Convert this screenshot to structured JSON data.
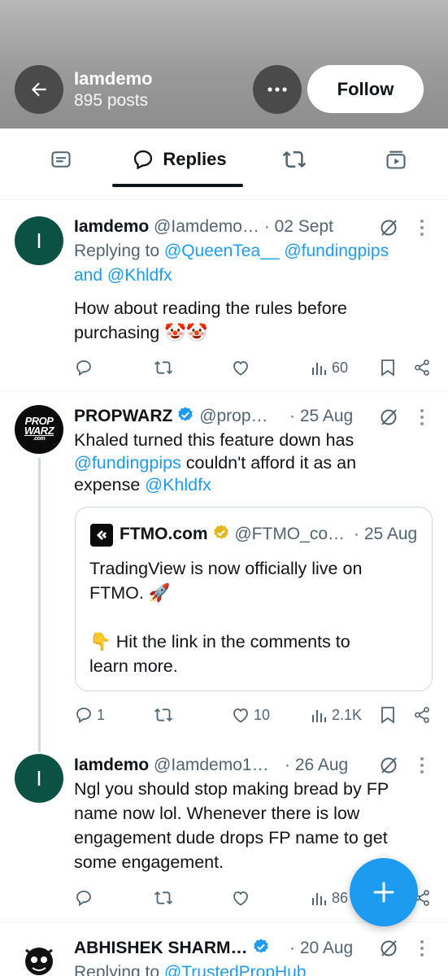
{
  "header": {
    "name": "Iamdemo",
    "posts_count": "895 posts",
    "follow_label": "Follow"
  },
  "tabs": {
    "replies_label": "Replies"
  },
  "posts": [
    {
      "name": "Iamdemo",
      "handle": "@Iamdemo…",
      "date": "· 02 Sept",
      "replying_prefix": "Replying to",
      "replying_to_1": "@QueenTea__",
      "replying_to_2": "@fundingpips",
      "replying_and": "and",
      "replying_to_3": "@Khldfx",
      "text_line_1": "How about reading the rules before",
      "text_line_2": "purchasing 🤡🤡",
      "stats": {
        "replies": "",
        "reposts": "",
        "likes": "",
        "views": "60"
      }
    },
    {
      "name": "PROPWARZ",
      "handle": "@prop…",
      "date": "· 25 Aug",
      "avatar_text_1": "PROP",
      "avatar_text_2": "WARZ",
      "avatar_text_3": ".com",
      "text_line_1": "Khaled turned this feature down has",
      "text_line_2_link": "@fundingpips",
      "text_line_2_rest": " couldn't afford it as an",
      "text_line_3_start": "expense ",
      "text_line_3_link": "@Khldfx",
      "quote": {
        "name": "FTMO.com",
        "handle": "@FTMO_co…",
        "date": "· 25 Aug",
        "text_line_1": "TradingView is now officially live on",
        "text_line_2": "FTMO. 🚀",
        "text_line_3": "👇 Hit the link in the comments to",
        "text_line_4": "learn more."
      },
      "stats": {
        "replies": "1",
        "reposts": "",
        "likes": "10",
        "views": "2.1K"
      }
    },
    {
      "name": "Iamdemo",
      "handle": "@Iamdemo1…",
      "date": "· 26 Aug",
      "text_line_1": "Ngl you should stop making bread by FP",
      "text_line_2": "name now lol. Whenever there is low",
      "text_line_3": "engagement dude drops FP name to get",
      "text_line_4": "some engagement.",
      "stats": {
        "replies": "",
        "reposts": "",
        "likes": "",
        "views": "86"
      }
    },
    {
      "name": "ABHISHEK SHARM…",
      "date": "· 20 Aug",
      "replying_prefix": "Replying to",
      "replying_to_1": "@TrustedPropHub"
    }
  ],
  "colors": {
    "accent": "#1d9bf0",
    "muted": "#536471",
    "verified_blue": "#1d9bf0",
    "verified_gold": "#e2b719",
    "avatar_green": "#0b5244"
  },
  "icons": [
    "back-arrow-icon",
    "more-icon",
    "posts-tab-icon",
    "replies-tab-icon",
    "reposts-tab-icon",
    "media-tab-icon",
    "grok-icon",
    "reply-icon",
    "repost-icon",
    "like-icon",
    "views-icon",
    "bookmark-icon",
    "share-icon",
    "compose-plus-icon"
  ]
}
